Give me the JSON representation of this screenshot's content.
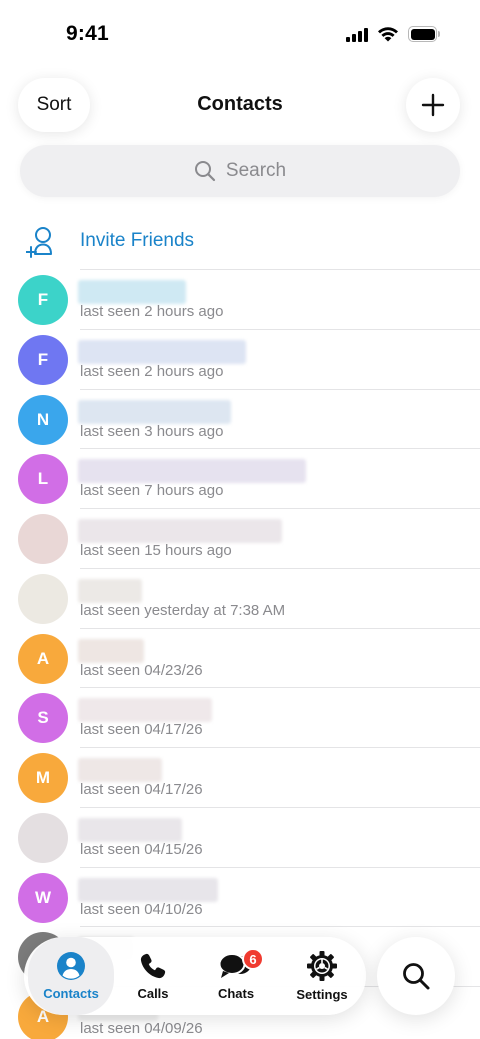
{
  "status_bar": {
    "time": "9:41"
  },
  "header": {
    "sort_label": "Sort",
    "title": "Contacts",
    "add_icon": "plus-icon"
  },
  "search": {
    "placeholder": "Search"
  },
  "invite": {
    "label": "Invite Friends",
    "icon": "add-person-icon"
  },
  "contacts": [
    {
      "initial": "F",
      "status": "last seen 2 hours ago",
      "avatar_color": "#3cd3c9"
    },
    {
      "initial": "F",
      "status": "last seen 2 hours ago",
      "avatar_color": "#6f77f2"
    },
    {
      "initial": "N",
      "status": "last seen 3 hours ago",
      "avatar_color": "#3aa6ec"
    },
    {
      "initial": "L",
      "status": "last seen 7 hours ago",
      "avatar_color": "#d16ee6"
    },
    {
      "initial": "",
      "status": "last seen 15 hours ago",
      "avatar_color": "#e9d7d6"
    },
    {
      "initial": "",
      "status": "last seen yesterday at 7:38 AM",
      "avatar_color": "#ece9e2"
    },
    {
      "initial": "A",
      "status": "last seen 04/23/26",
      "avatar_color": "#f8a93c"
    },
    {
      "initial": "S",
      "status": "last seen 04/17/26",
      "avatar_color": "#d16ee6"
    },
    {
      "initial": "M",
      "status": "last seen 04/17/26",
      "avatar_color": "#f8a93c"
    },
    {
      "initial": "",
      "status": "last seen 04/15/26",
      "avatar_color": "#e4dfe1"
    },
    {
      "initial": "W",
      "status": "last seen 04/10/26",
      "avatar_color": "#d16ee6"
    },
    {
      "initial": "",
      "status": "",
      "avatar_color": "#7c7c7c"
    },
    {
      "initial": "A",
      "status": "last seen 04/09/26",
      "avatar_color": "#f8a93c"
    }
  ],
  "tabbar": {
    "tabs": [
      {
        "label": "Contacts",
        "icon": "person-circle-icon",
        "active": true
      },
      {
        "label": "Calls",
        "icon": "phone-icon"
      },
      {
        "label": "Chats",
        "icon": "chat-bubbles-icon",
        "badge": "6"
      },
      {
        "label": "Settings",
        "icon": "gear-icon"
      }
    ],
    "search_icon": "search-icon"
  },
  "colors": {
    "accent": "#1a83c9",
    "badge": "#f03b30",
    "secondary_text": "#8a8a8e"
  }
}
